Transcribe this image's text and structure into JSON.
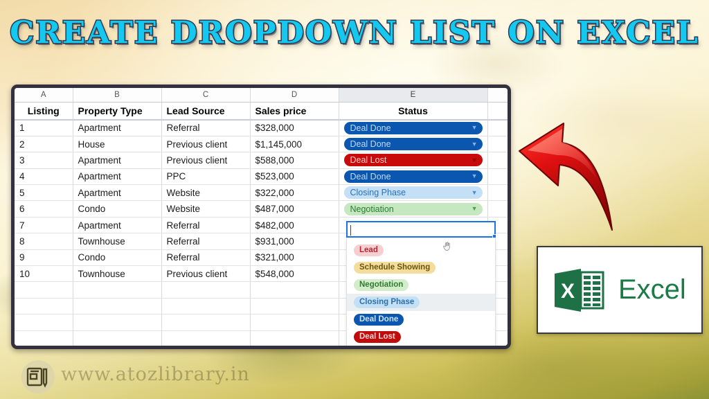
{
  "title": "CREATE DROPDOWN LIST ON EXCEL",
  "title_color": "#14c8f0",
  "spreadsheet": {
    "column_letters": [
      "A",
      "B",
      "C",
      "D",
      "E",
      ""
    ],
    "active_column_letter": "E",
    "headers": [
      "Listing",
      "Property Type",
      "Lead Source",
      "Sales price",
      "Status"
    ],
    "rows": [
      {
        "listing": "1",
        "property_type": "Apartment",
        "lead_source": "Referral",
        "sales_price": "$328,000",
        "status": "Deal Done",
        "status_style": "deal-done"
      },
      {
        "listing": "2",
        "property_type": "House",
        "lead_source": "Previous client",
        "sales_price": "$1,145,000",
        "status": "Deal Done",
        "status_style": "deal-done"
      },
      {
        "listing": "3",
        "property_type": "Apartment",
        "lead_source": "Previous client",
        "sales_price": "$588,000",
        "status": "Deal Lost",
        "status_style": "deal-lost"
      },
      {
        "listing": "4",
        "property_type": "Apartment",
        "lead_source": "PPC",
        "sales_price": "$523,000",
        "status": "Deal Done",
        "status_style": "deal-done"
      },
      {
        "listing": "5",
        "property_type": "Apartment",
        "lead_source": "Website",
        "sales_price": "$322,000",
        "status": "Closing Phase",
        "status_style": "closing"
      },
      {
        "listing": "6",
        "property_type": "Condo",
        "lead_source": "Website",
        "sales_price": "$487,000",
        "status": "Negotiation",
        "status_style": "negotiation"
      },
      {
        "listing": "7",
        "property_type": "Apartment",
        "lead_source": "Referral",
        "sales_price": "$482,000",
        "status": "",
        "status_style": "empty-selected"
      },
      {
        "listing": "8",
        "property_type": "Townhouse",
        "lead_source": "Referral",
        "sales_price": "$931,000",
        "status": "",
        "status_style": "empty"
      },
      {
        "listing": "9",
        "property_type": "Condo",
        "lead_source": "Referral",
        "sales_price": "$321,000",
        "status": "",
        "status_style": "empty"
      },
      {
        "listing": "10",
        "property_type": "Townhouse",
        "lead_source": "Previous client",
        "sales_price": "$548,000",
        "status": "",
        "status_style": "empty"
      }
    ],
    "empty_row_count": 5,
    "chip_caret_glyph": "▼"
  },
  "dropdown": {
    "open": true,
    "hovered_option": "Closing Phase",
    "cursor_icon": "pointing-hand-cursor",
    "options": [
      {
        "label": "Lead",
        "style": "lead"
      },
      {
        "label": "Schedule Showing",
        "style": "schedule"
      },
      {
        "label": "Negotiation",
        "style": "negotiation"
      },
      {
        "label": "Closing Phase",
        "style": "closing"
      },
      {
        "label": "Deal Done",
        "style": "dealdone"
      },
      {
        "label": "Deal Lost",
        "style": "deallost"
      }
    ]
  },
  "annotations": {
    "arrow_icon": "curved-red-arrow",
    "arrow_color": "#d81010"
  },
  "excel_card": {
    "word": "Excel",
    "logo_letter": "X",
    "brand_color": "#1b7a45"
  },
  "watermark": {
    "text": "www.atozlibrary.in",
    "logo_icon": "book-and-pen-logo"
  },
  "colors": {
    "deal_done_bg": "#0b57b0",
    "deal_lost_bg": "#c80a0a",
    "closing_phase_bg": "#c3e0f7",
    "negotiation_bg": "#c6e8c0",
    "lead_bg": "#f7cfd2",
    "schedule_bg": "#f4dc9c",
    "selection_border": "#1a73e8"
  }
}
